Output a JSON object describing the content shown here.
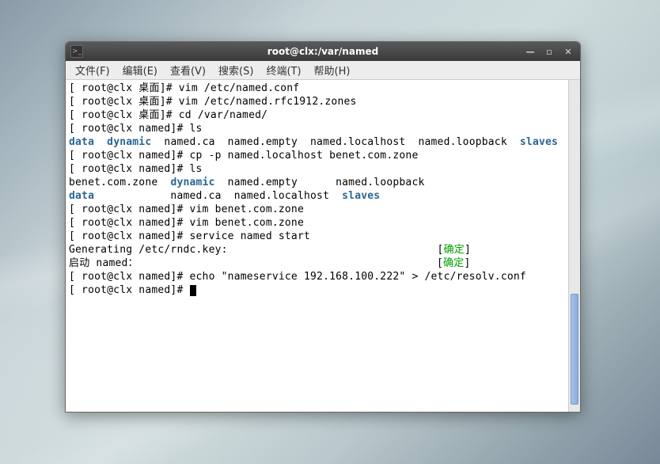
{
  "window": {
    "title": "root@clx:/var/named"
  },
  "menubar": {
    "file": "文件(F)",
    "edit": "编辑(E)",
    "view": "查看(V)",
    "search": "搜索(S)",
    "terminal": "终端(T)",
    "help": "帮助(H)"
  },
  "terminal": {
    "lines": [
      {
        "type": "cmd",
        "prompt": "[ root@clx 桌面]# ",
        "cmd": "vim /etc/named.conf"
      },
      {
        "type": "cmd",
        "prompt": "[ root@clx 桌面]# ",
        "cmd": "vim /etc/named.rfc1912.zones"
      },
      {
        "type": "cmd",
        "prompt": "[ root@clx 桌面]# ",
        "cmd": "cd /var/named/"
      },
      {
        "type": "cmd",
        "prompt": "[ root@clx named]# ",
        "cmd": "ls"
      },
      {
        "type": "ls1"
      },
      {
        "type": "cmd",
        "prompt": "[ root@clx named]# ",
        "cmd": "cp -p named.localhost benet.com.zone"
      },
      {
        "type": "cmd",
        "prompt": "[ root@clx named]# ",
        "cmd": "ls"
      },
      {
        "type": "ls2a"
      },
      {
        "type": "ls2b"
      },
      {
        "type": "cmd",
        "prompt": "[ root@clx named]# ",
        "cmd": "vim benet.com.zone"
      },
      {
        "type": "cmd",
        "prompt": "[ root@clx named]# ",
        "cmd": "vim benet.com.zone"
      },
      {
        "type": "cmd",
        "prompt": "[ root@clx named]# ",
        "cmd": "service named start"
      },
      {
        "type": "status",
        "text": "Generating /etc/rndc.key:",
        "status": "确定"
      },
      {
        "type": "status",
        "text": "启动 named：",
        "status": "确定"
      },
      {
        "type": "cmd",
        "prompt": "[ root@clx named]# ",
        "cmd": "echo \"nameservice 192.168.100.222\" > /etc/resolv.conf"
      },
      {
        "type": "cursor",
        "prompt": "[ root@clx named]# "
      }
    ],
    "ls1": {
      "data": "data",
      "dynamic": "dynamic",
      "rest": "  named.ca  named.empty  named.localhost  named.loopback  ",
      "slaves": "slaves"
    },
    "ls2a": {
      "c1": "benet.com.zone  ",
      "dynamic": "dynamic",
      "rest": "  named.empty      named.loopback"
    },
    "ls2b": {
      "data": "data",
      "pad": "            named.ca  named.localhost  ",
      "slaves": "slaves"
    },
    "status_pad1": "                                 [",
    "status_pad2": "                                               [",
    "status_close": "]"
  }
}
